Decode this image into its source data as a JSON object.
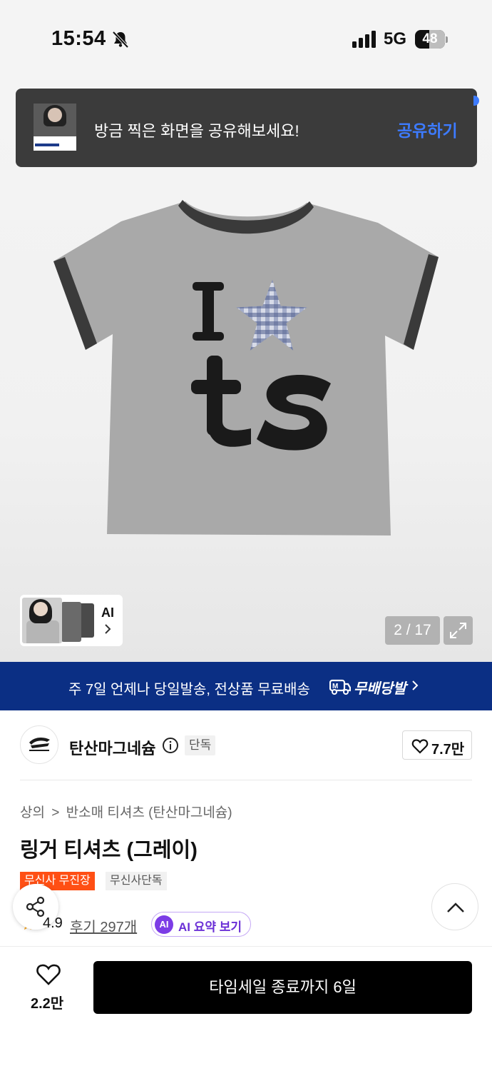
{
  "status_bar": {
    "time": "15:54",
    "network": "5G",
    "battery": "48"
  },
  "toast": {
    "message": "방금 찍은 화면을 공유해보세요!",
    "action": "공유하기"
  },
  "gallery": {
    "ai_label": "AI",
    "counter": "2 / 17"
  },
  "shipping": {
    "text": "주 7일 언제나 당일발송, 전상품 무료배송",
    "logo_text": "무배당발"
  },
  "brand": {
    "name": "탄산마그네슘",
    "badge": "단독",
    "likes": "7.7만"
  },
  "breadcrumb": {
    "category": "상의",
    "separator": ">",
    "subcategory": "반소매 티셔츠 (탄산마그네슘)"
  },
  "product": {
    "title": "링거 티셔츠 (그레이)",
    "tags": [
      "무신사 무진장",
      "무신사단독"
    ],
    "rating": "4.9",
    "reviews": "후기 297개",
    "ai_summary": "AI 요약 보기",
    "ai_badge": "AI"
  },
  "bottom_bar": {
    "wish_count": "2.2만",
    "cta_label": "타임세일 종료까지 6일"
  },
  "colors": {
    "accent_blue": "#3d7bff",
    "banner_navy": "#0b2f84",
    "tag_orange": "#ff4f14",
    "ai_purple": "#7c3ce6"
  }
}
